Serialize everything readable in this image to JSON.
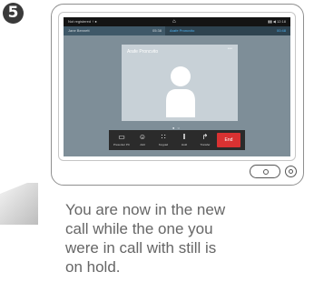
{
  "step": {
    "number": "5"
  },
  "status_bar": {
    "left_text": "Not registered ↑ ●",
    "right_text": "▮▮ ◀ 12:18"
  },
  "calls": [
    {
      "name": "Jane Bennett",
      "time": "05:38"
    },
    {
      "name": "Arafe Proncvito",
      "time": "00:48"
    }
  ],
  "video": {
    "participant_name": "Arafe Proncvito",
    "menu_dots": "•••",
    "page_dots": "● ○"
  },
  "toolbar": {
    "items": [
      {
        "glyph": "▭",
        "label": "Presenter PC"
      },
      {
        "glyph": "☺",
        "label": "Add"
      },
      {
        "glyph": "∷",
        "label": "Keypad"
      },
      {
        "glyph": "‖",
        "label": "Hold"
      },
      {
        "glyph": "↱",
        "label": "Transfer"
      }
    ],
    "end_label": "End"
  },
  "caption": "You are now in the new\ncall while the one you\nwere in call with still is\non hold.",
  "colors": {
    "end_button": "#d93232",
    "active_call": "#4db0ee",
    "screen_background": "#7e8e98",
    "caption_text": "#666666"
  }
}
